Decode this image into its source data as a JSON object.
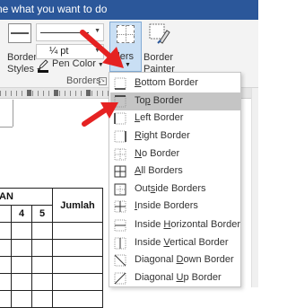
{
  "tellbar": {
    "text": "ne what you want to do"
  },
  "ribbon": {
    "border_styles_line1": "Border",
    "border_styles_line2": "Styles",
    "line_weight_value": "¼ pt",
    "pen_color_label": "Pen Color",
    "borders_label_visible": "rders",
    "border_painter_line1": "Border",
    "border_painter_line2": "Painter",
    "group_label": "Borders"
  },
  "menu": {
    "items": [
      {
        "pre": "",
        "u": "B",
        "post": "ottom Border",
        "icon": "bottom-border-icon"
      },
      {
        "pre": "To",
        "u": "p",
        "post": " Border",
        "icon": "top-border-icon"
      },
      {
        "pre": "",
        "u": "L",
        "post": "eft Border",
        "icon": "left-border-icon"
      },
      {
        "pre": "",
        "u": "R",
        "post": "ight Border",
        "icon": "right-border-icon"
      },
      {
        "pre": "",
        "u": "N",
        "post": "o Border",
        "icon": "no-border-icon"
      },
      {
        "pre": "",
        "u": "A",
        "post": "ll Borders",
        "icon": "all-borders-icon"
      },
      {
        "pre": "Out",
        "u": "s",
        "post": "ide Borders",
        "icon": "outside-borders-icon"
      },
      {
        "pre": "",
        "u": "I",
        "post": "nside Borders",
        "icon": "inside-borders-icon"
      },
      {
        "pre": "Inside ",
        "u": "H",
        "post": "orizontal Border",
        "icon": "inside-horizontal-border-icon"
      },
      {
        "pre": "Inside ",
        "u": "V",
        "post": "ertical Border",
        "icon": "inside-vertical-border-icon"
      },
      {
        "pre": "Diagonal ",
        "u": "D",
        "post": "own Border",
        "icon": "diagonal-down-border-icon"
      },
      {
        "pre": "Diagonal ",
        "u": "U",
        "post": "p Border",
        "icon": "diagonal-up-border-icon"
      }
    ],
    "selected_index": 1
  },
  "document": {
    "header_partial": "AN",
    "col_4": "4",
    "col_5": "5",
    "col_jumlah": "Jumlah"
  },
  "colors": {
    "title_bar": "#2b579a",
    "ribbon_bg": "#f3f3f3",
    "borders_button_active": "#c9dff4",
    "menu_selected": "#c5c5c5",
    "arrow": "#e52222"
  }
}
